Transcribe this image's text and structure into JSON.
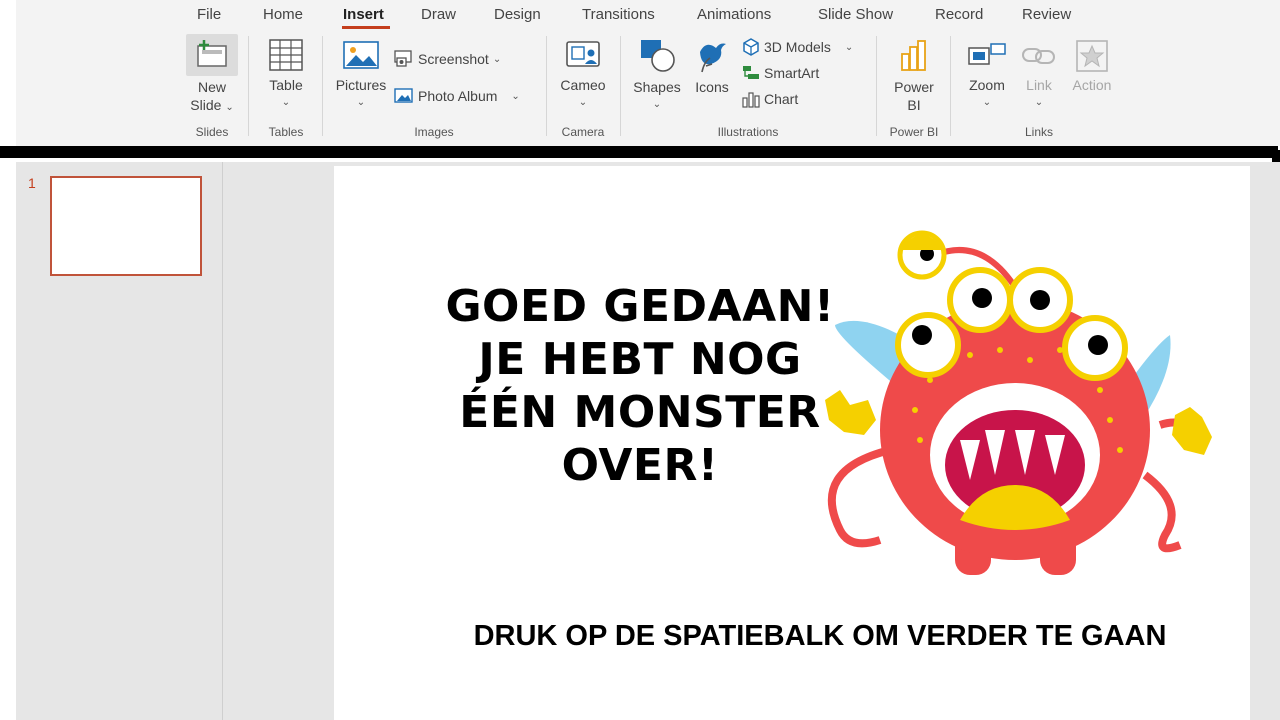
{
  "ribbon": {
    "tabs": [
      "File",
      "Home",
      "Insert",
      "Draw",
      "Design",
      "Transitions",
      "Animations",
      "Slide Show",
      "Record",
      "Review"
    ],
    "active_tab": "Insert",
    "slides_group": {
      "label": "Slides",
      "new_slide_line1": "New",
      "new_slide_line2": "Slide"
    },
    "tables_group": {
      "label": "Tables",
      "table": "Table"
    },
    "images_group": {
      "label": "Images",
      "pictures": "Pictures",
      "screenshot": "Screenshot",
      "photo_album": "Photo Album"
    },
    "camera_group": {
      "label": "Camera",
      "cameo": "Cameo"
    },
    "illustrations_group": {
      "label": "Illustrations",
      "shapes": "Shapes",
      "icons": "Icons",
      "models_3d": "3D Models",
      "smartart": "SmartArt",
      "chart": "Chart"
    },
    "powerbi_group": {
      "label": "Power BI",
      "power_line1": "Power",
      "power_line2": "BI"
    },
    "links_group": {
      "label": "Links",
      "zoom": "Zoom",
      "link": "Link",
      "action": "Action"
    }
  },
  "thumbnails": {
    "slide_number": "1"
  },
  "slide": {
    "headline": [
      "GOED GEDAAN!",
      "JE HEBT NOG",
      "ÉÉN MONSTER",
      "OVER!"
    ],
    "instruction": "DRUK OP DE SPATIEBALK OM VERDER TE GAAN"
  },
  "colors": {
    "accent": "#c43e1c",
    "ribbon_bg": "#f3f3f3",
    "pane_bg": "#e6e6e6",
    "monster_body": "#ef4a4a",
    "monster_wings": "#8fd3f0",
    "monster_yellow": "#f5d000"
  }
}
